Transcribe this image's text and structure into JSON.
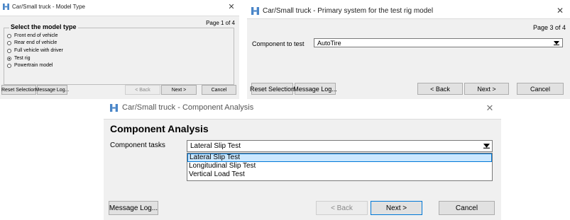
{
  "brand_color": "#4a86c8",
  "dialog1": {
    "title": "Car/Small truck - Model Type",
    "close_icon": "close-icon",
    "page_indicator": "Page 1 of 4",
    "group_title": "Select the model type",
    "options": [
      {
        "label": "Front end of vehicle",
        "checked": false
      },
      {
        "label": "Rear end of vehicle",
        "checked": false
      },
      {
        "label": "Full vehicle with driver",
        "checked": false
      },
      {
        "label": "Test rig",
        "checked": true
      },
      {
        "label": "Powertrain model",
        "checked": false
      }
    ],
    "buttons": {
      "reset": "Reset Selection",
      "message_log": "Message Log...",
      "back": "< Back",
      "next": "Next >",
      "cancel": "Cancel"
    }
  },
  "dialog2": {
    "title": "Car/Small truck - Primary system for the test rig model",
    "close_icon": "close-icon",
    "page_indicator": "Page 3 of 4",
    "component_label": "Component to test",
    "component_value": "AutoTire",
    "buttons": {
      "reset": "Reset Selection",
      "message_log": "Message Log...",
      "back": "< Back",
      "next": "Next >",
      "cancel": "Cancel"
    }
  },
  "dialog3": {
    "title": "Car/Small truck - Component Analysis",
    "close_icon": "close-icon",
    "heading": "Component Analysis",
    "tasks_label": "Component tasks",
    "tasks_value": "Lateral Slip Test",
    "tasks_options": [
      "Lateral Slip Test",
      "Longitudinal Slip Test",
      "Vertical Load Test"
    ],
    "selected_index": 0,
    "buttons": {
      "message_log": "Message Log...",
      "back": "< Back",
      "next": "Next >",
      "cancel": "Cancel"
    }
  }
}
